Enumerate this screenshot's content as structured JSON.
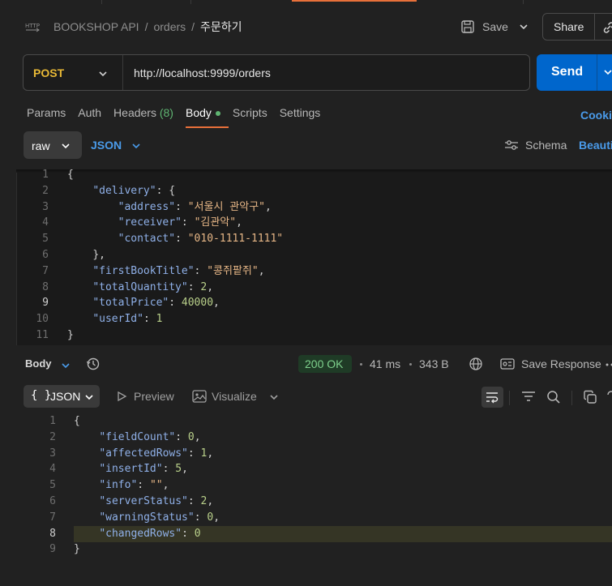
{
  "header": {
    "breadcrumb": [
      "BOOKSHOP API",
      "orders",
      "주문하기"
    ],
    "save_label": "Save",
    "share_label": "Share"
  },
  "request": {
    "method": "POST",
    "url": "http://localhost:9999/orders",
    "send_label": "Send",
    "tabs": [
      {
        "label": "Params"
      },
      {
        "label": "Auth"
      },
      {
        "label": "Headers",
        "count": "(8)"
      },
      {
        "label": "Body",
        "active": true
      },
      {
        "label": "Scripts"
      },
      {
        "label": "Settings"
      }
    ],
    "cookies_label": "Cookie",
    "body_mode": "raw",
    "body_format": "JSON",
    "schema_label": "Schema",
    "beautify_label": "Beauti"
  },
  "request_body_lines": [
    {
      "n": "1",
      "text": "{"
    },
    {
      "n": "2",
      "text": "    \"delivery\": {"
    },
    {
      "n": "3",
      "text": "        \"address\": \"서울시 관악구\","
    },
    {
      "n": "4",
      "text": "        \"receiver\": \"김관악\","
    },
    {
      "n": "5",
      "text": "        \"contact\": \"010-1111-1111\""
    },
    {
      "n": "6",
      "text": "    },"
    },
    {
      "n": "7",
      "text": "    \"firstBookTitle\": \"콩쥐팥쥐\","
    },
    {
      "n": "8",
      "text": "    \"totalQuantity\": 2,"
    },
    {
      "n": "9",
      "text": "    \"totalPrice\": 40000,"
    },
    {
      "n": "10",
      "text": "    \"userId\": 1"
    },
    {
      "n": "11",
      "text": "}"
    }
  ],
  "response": {
    "body_label": "Body",
    "status": "200 OK",
    "time": "41 ms",
    "size": "343 B",
    "save_response_label": "Save Response",
    "format_label": "JSON",
    "preview_label": "Preview",
    "visualize_label": "Visualize"
  },
  "response_body_lines": [
    {
      "n": "1",
      "text": "{"
    },
    {
      "n": "2",
      "text": "    \"fieldCount\": 0,"
    },
    {
      "n": "3",
      "text": "    \"affectedRows\": 1,"
    },
    {
      "n": "4",
      "text": "    \"insertId\": 5,"
    },
    {
      "n": "5",
      "text": "    \"info\": \"\","
    },
    {
      "n": "6",
      "text": "    \"serverStatus\": 2,"
    },
    {
      "n": "7",
      "text": "    \"warningStatus\": 0,"
    },
    {
      "n": "8",
      "text": "    \"changedRows\": 0"
    },
    {
      "n": "9",
      "text": "}"
    }
  ],
  "colors": {
    "method": "#e8b936",
    "accent_blue": "#0066cc",
    "active_tab_underline": "#e8703a",
    "status_ok": "#7ed18c"
  }
}
